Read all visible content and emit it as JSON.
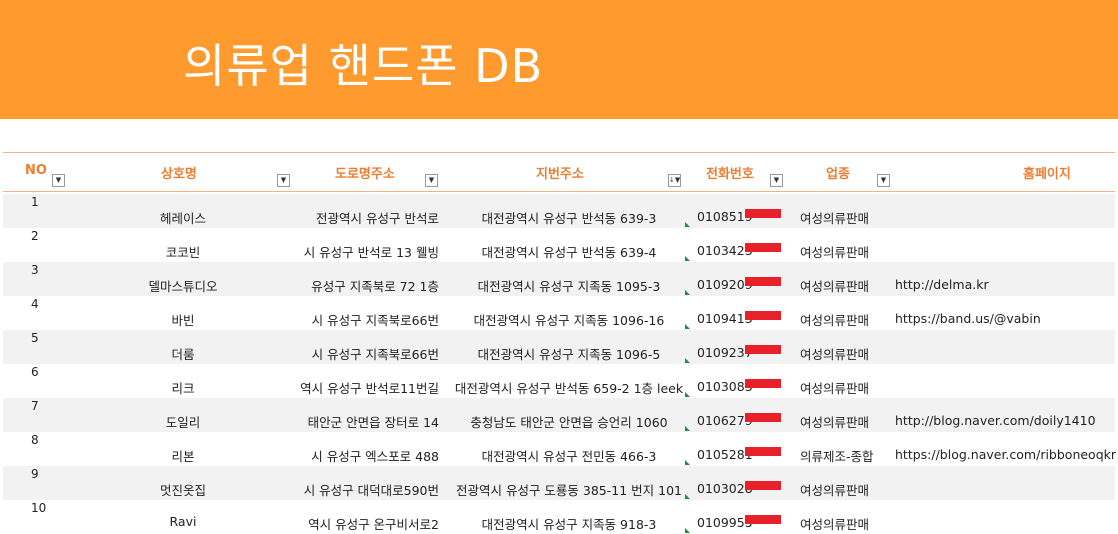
{
  "title": "의류업 핸드폰 DB",
  "headers": {
    "no": "NO",
    "name": "상호명",
    "road": "도로명주소",
    "jibun": "지번주소",
    "phone": "전화번호",
    "biz": "업종",
    "home": "홈페이지"
  },
  "rows": [
    {
      "no": "1",
      "name": "헤레이스",
      "road": "전광역시 유성구 반석로",
      "jibun": "대전광역시 유성구 반석동   639-3",
      "phone": "0108519",
      "biz": "여성의류판매",
      "home": ""
    },
    {
      "no": "2",
      "name": "코코빈",
      "road": "시 유성구 반석로 13 웰빙",
      "jibun": "대전광역시 유성구 반석동 639-4",
      "phone": "0103423",
      "biz": "여성의류판매",
      "home": ""
    },
    {
      "no": "3",
      "name": "델마스튜디오",
      "road": "유성구 지족북로 72 1층",
      "jibun": "대전광역시 유성구 지족동 1095-3",
      "phone": "0109209",
      "biz": "여성의류판매",
      "home": "http://delma.kr"
    },
    {
      "no": "4",
      "name": "바빈",
      "road": "시 유성구 지족북로66번",
      "jibun": "대전광역시 유성구 지족동 1096-16",
      "phone": "0109413",
      "biz": "여성의류판매",
      "home": "https://band.us/@vabin"
    },
    {
      "no": "5",
      "name": "더룸",
      "road": "시 유성구 지족북로66번",
      "jibun": "대전광역시 유성구 지족동 1096-5",
      "phone": "0109237",
      "biz": "여성의류판매",
      "home": ""
    },
    {
      "no": "6",
      "name": "리크",
      "road": "역시 유성구 반석로11번길",
      "jibun": "대전광역시 유성구 반석동 659-2 1층 leek",
      "phone": "0103083",
      "biz": "여성의류판매",
      "home": ""
    },
    {
      "no": "7",
      "name": "도일리",
      "road": "태안군 안면읍 장터로 14",
      "jibun": "충청남도 태안군 안면읍 승언리 1060",
      "phone": "0106279",
      "biz": "여성의류판매",
      "home": "http://blog.naver.com/doily1410"
    },
    {
      "no": "8",
      "name": "리본",
      "road": "시 유성구 엑스포로 488",
      "jibun": "대전광역시 유성구 전민동 466-3",
      "phone": "0105281",
      "biz": "의류제조-종합",
      "home": "https://blog.naver.com/ribboneoqkr"
    },
    {
      "no": "9",
      "name": "멋진옷집",
      "road": "시 유성구 대덕대로590번",
      "jibun": "전광역시 유성구 도룡동 385-11 번지 101",
      "phone": "0103028",
      "biz": "여성의류판매",
      "home": ""
    },
    {
      "no": "10",
      "name": "Ravi",
      "road": "역시 유성구 온구비서로2",
      "jibun": "대전광역시 유성구 지족동 918-3",
      "phone": "0109955",
      "biz": "여성의류판매",
      "home": ""
    }
  ]
}
